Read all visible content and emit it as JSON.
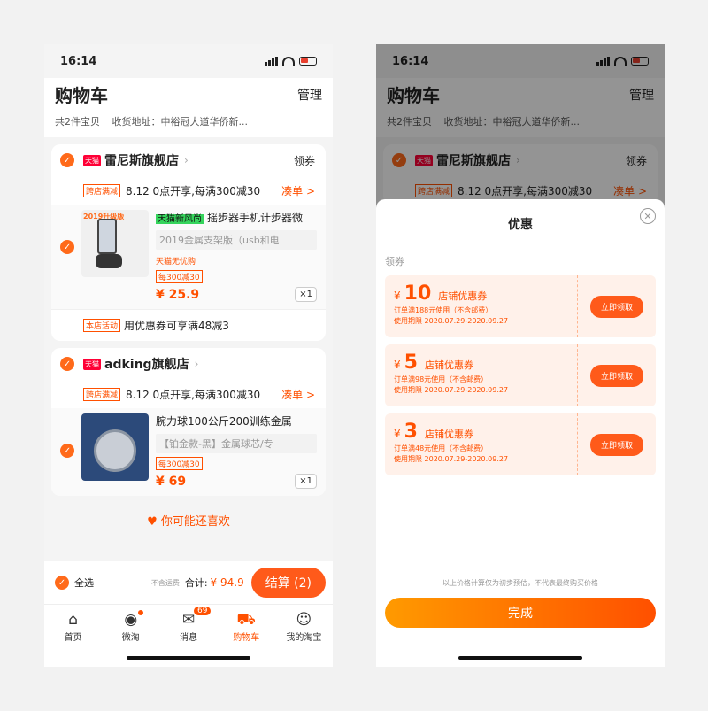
{
  "status": {
    "time": "16:14"
  },
  "header": {
    "title": "购物车",
    "manage": "管理",
    "count_text": "共2件宝贝",
    "address_text": "收货地址：中裕冠大道华侨新..."
  },
  "stores": [
    {
      "badge": "天猫",
      "name": "雷尼斯旗舰店",
      "coupon_link": "领券",
      "promo_tag": "跨店满减",
      "promo_text": "8.12 0点开享,每满300减30",
      "promo_link": "凑单 >",
      "item": {
        "thumb_label": "2019升级版",
        "green_tag": "天猫新风尚",
        "title": "摇步器手机计步器微",
        "spec": "2019金属支架版（usb和电",
        "guarantee": "天猫无忧购",
        "discount_tag": "每300减30",
        "price": "¥ 25.9",
        "qty": "×1"
      },
      "activity_tag": "本店活动",
      "activity_text": "用优惠券可享满48减3"
    },
    {
      "badge": "天猫",
      "name": "adking旗舰店",
      "promo_tag": "跨店满减",
      "promo_text": "8.12 0点开享,每满300减30",
      "promo_link": "凑单 >",
      "item": {
        "title": "腕力球100公斤200训练金属",
        "spec": "【铂金款-黑】金属球芯/专",
        "discount_tag": "每300减30",
        "price": "¥ 69",
        "qty": "×1"
      }
    }
  ],
  "guess_text": "你可能还喜欢",
  "checkout": {
    "select_all": "全选",
    "freight": "不含运费",
    "total_label": "合计:",
    "total": "¥ 94.9",
    "settle": "结算 (2)"
  },
  "tabs": [
    {
      "label": "首页",
      "icon": "home-icon"
    },
    {
      "label": "微淘",
      "icon": "broadcast-icon"
    },
    {
      "label": "消息",
      "icon": "message-icon",
      "badge": "69"
    },
    {
      "label": "购物车",
      "icon": "cart-icon"
    },
    {
      "label": "我的淘宝",
      "icon": "user-icon"
    }
  ],
  "sheet": {
    "title": "优惠",
    "section_label": "领券",
    "coupons": [
      {
        "yen": "¥",
        "amount": "10",
        "name": "店铺优惠券",
        "condition": "订单满188元使用（不含邮费）",
        "period": "使用期限 2020.07.29-2020.09.27",
        "button": "立即领取"
      },
      {
        "yen": "¥",
        "amount": "5",
        "name": "店铺优惠券",
        "condition": "订单满98元使用（不含邮费）",
        "period": "使用期限 2020.07.29-2020.09.27",
        "button": "立即领取"
      },
      {
        "yen": "¥",
        "amount": "3",
        "name": "店铺优惠券",
        "condition": "订单满48元使用（不含邮费）",
        "period": "使用期限 2020.07.29-2020.09.27",
        "button": "立即领取"
      }
    ],
    "disclaimer": "以上价格计算仅为初步预估，不代表最终购买价格",
    "done": "完成"
  },
  "colors": {
    "accent": "#ff5000",
    "checkbox": "#ff6a1a",
    "tmall": "#ff0036"
  }
}
